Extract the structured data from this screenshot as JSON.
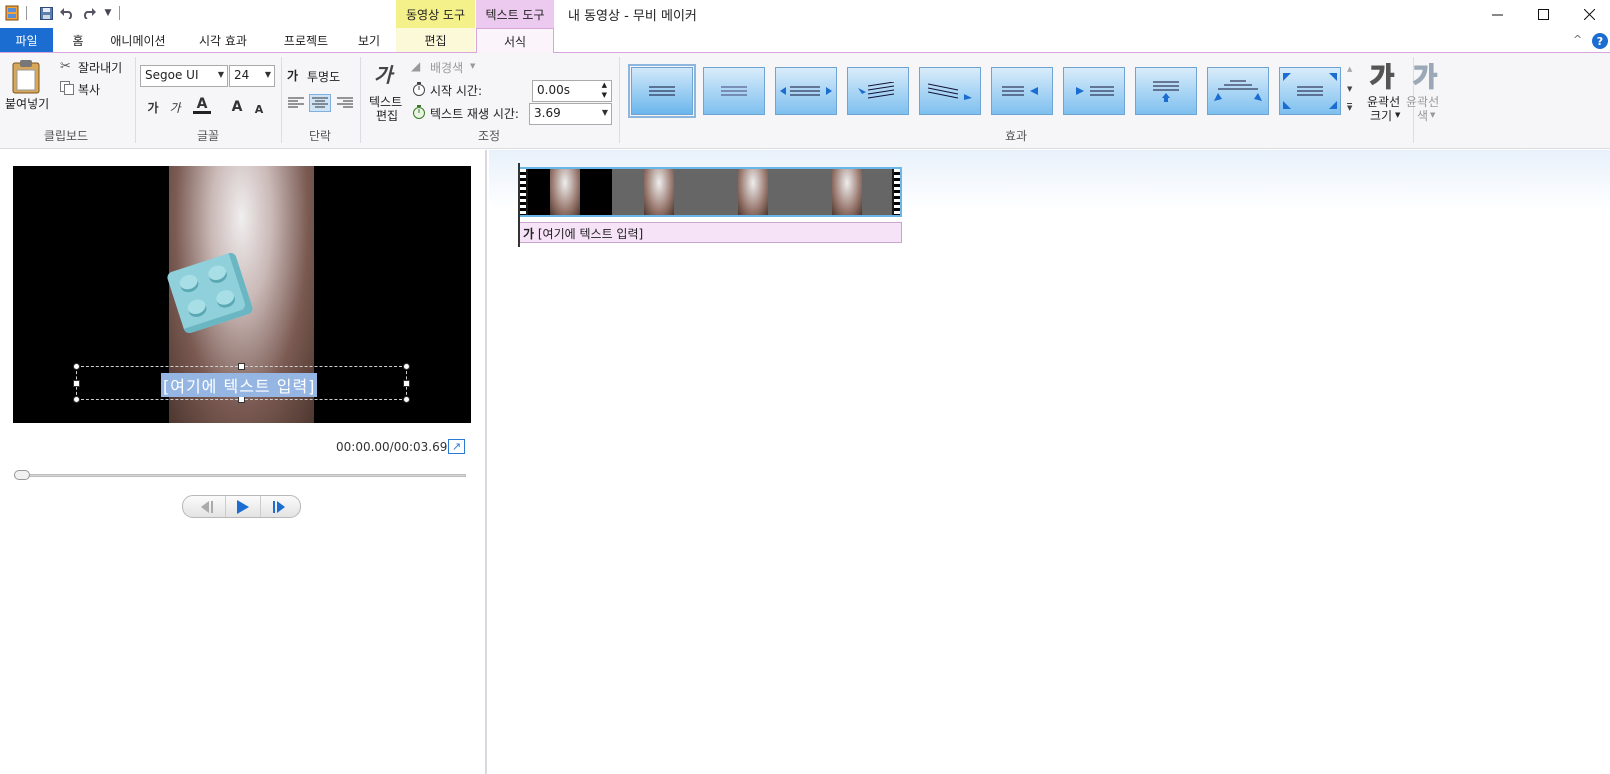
{
  "window": {
    "title": "내 동영상 - 무비 메이커",
    "ctx_video_tools": "동영상 도구",
    "ctx_text_tools": "텍스트 도구"
  },
  "tabs": {
    "file": "파일",
    "home": "홈",
    "animation": "애니메이션",
    "visual_effects": "시각 효과",
    "project": "프로젝트",
    "view": "보기",
    "edit": "편집",
    "format": "서식"
  },
  "ribbon": {
    "clipboard": {
      "paste": "붙여넣기",
      "cut": "잘라내기",
      "copy": "복사",
      "label": "클립보드"
    },
    "font": {
      "family": "Segoe UI",
      "size": "24",
      "label": "글꼴",
      "bold": "가",
      "italic": "가",
      "color": "A",
      "grow": "A",
      "shrink": "A"
    },
    "paragraph": {
      "transparency": "투명도",
      "label": "단락"
    },
    "adjust": {
      "edit_text": "텍스트",
      "edit_text2": "편집",
      "background_color": "배경색",
      "start_time_label": "시작 시간:",
      "start_time_value": "0.00s",
      "duration_label": "텍스트 재생 시간:",
      "duration_value": "3.69",
      "label": "조정"
    },
    "effects": {
      "label": "효과"
    },
    "outline": {
      "size_label1": "윤곽선",
      "size_label2": "크기",
      "color_label1": "윤곽선",
      "color_label2": "색",
      "glyph": "가"
    }
  },
  "preview": {
    "caption": "[여기에 텍스트 입력]",
    "time": "00:00.00/00:03.69",
    "seek_position": 0.0
  },
  "timeline": {
    "caption_glyph": "가",
    "caption": "[여기에 텍스트 입력]"
  },
  "colors": {
    "file_tab": "#1b6dd1",
    "ctx_video": "#f4f08a",
    "ctx_text": "#ecc9ee",
    "clip_border": "#69b6e8"
  }
}
